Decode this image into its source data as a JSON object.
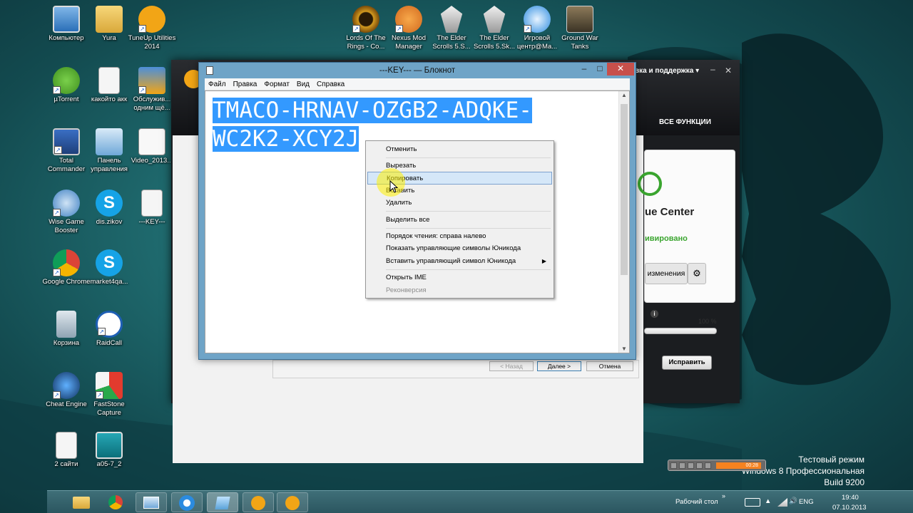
{
  "desktop_icons": [
    {
      "id": "computer",
      "label": "Компьютер"
    },
    {
      "id": "yura",
      "label": "Yura"
    },
    {
      "id": "tuneup",
      "label": "TuneUp Utilities 2014"
    },
    {
      "id": "utorrent",
      "label": "µTorrent"
    },
    {
      "id": "kakoito",
      "label": "какойто акк"
    },
    {
      "id": "service",
      "label": "Обслужив... одним щё..."
    },
    {
      "id": "totalcmd",
      "label": "Total Commander"
    },
    {
      "id": "control",
      "label": "Панель управления"
    },
    {
      "id": "video",
      "label": "Video_2013..."
    },
    {
      "id": "wisegame",
      "label": "Wise Game Booster"
    },
    {
      "id": "diszikov",
      "label": "dis.zikov"
    },
    {
      "id": "keyfile",
      "label": "---KEY---"
    },
    {
      "id": "chrome",
      "label": "Google Chrome"
    },
    {
      "id": "market",
      "label": "market4qa..."
    },
    {
      "id": "recycle",
      "label": "Корзина"
    },
    {
      "id": "raidcall",
      "label": "RaidCall"
    },
    {
      "id": "cheat",
      "label": "Cheat Engine"
    },
    {
      "id": "faststone",
      "label": "FastStone Capture"
    },
    {
      "id": "twosites",
      "label": "2 сайти"
    },
    {
      "id": "a05",
      "label": "a05-7_2"
    },
    {
      "id": "lotr",
      "label": "Lords Of The Rings - Co..."
    },
    {
      "id": "nexus",
      "label": "Nexus Mod Manager"
    },
    {
      "id": "skyrim1",
      "label": "The Elder Scrolls 5.S..."
    },
    {
      "id": "skyrim2",
      "label": "The Elder Scrolls 5.Sk..."
    },
    {
      "id": "gamecenter",
      "label": "Игровой центр@Ма..."
    },
    {
      "id": "groundwar",
      "label": "Ground War Tanks"
    }
  ],
  "background_app": {
    "support_link": "вка и поддержка ▾",
    "all_functions": "ВСЕ ФУНКЦИИ",
    "center_title": "ue Center",
    "activated": "ивировано",
    "changes_btn": "изменения",
    "percent": "100 %",
    "fix_btn": "Исправить"
  },
  "notepad": {
    "title": "---KEY--- — Блокнот",
    "menu": [
      "Файл",
      "Правка",
      "Формат",
      "Вид",
      "Справка"
    ],
    "line1": "TMACO-HRNAV-OZGB2-ADQKE-",
    "line2": "WC2K2-XCY2J"
  },
  "context_menu": {
    "undo": "Отменить",
    "cut": "Вырезать",
    "copy": "Копировать",
    "paste": "Вставить",
    "delete": "Удалить",
    "select_all": "Выделить все",
    "rtl": "Порядок чтения: справа налево",
    "show_unicode": "Показать управляющие символы Юникода",
    "insert_unicode": "Вставить управляющий символ Юникода",
    "open_ime": "Открыть IME",
    "reconversion": "Реконверсия"
  },
  "wizard": {
    "back": "< Назад",
    "next": "Далее >",
    "cancel": "Отмена"
  },
  "taskbar": {
    "desktop_label": "Рабочий стол",
    "lang": "ENG",
    "time": "19:40",
    "date": "07.10.2013"
  },
  "watermark": {
    "line1": "Тестовый режим",
    "line2": "Windows 8 Профессиональная",
    "line3": "Build 9200"
  },
  "player": {
    "time": "00:28"
  },
  "colors": {
    "selection": "#3399ff",
    "menu_highlight": "#d5e7f8",
    "accent_orange": "#f58220"
  }
}
